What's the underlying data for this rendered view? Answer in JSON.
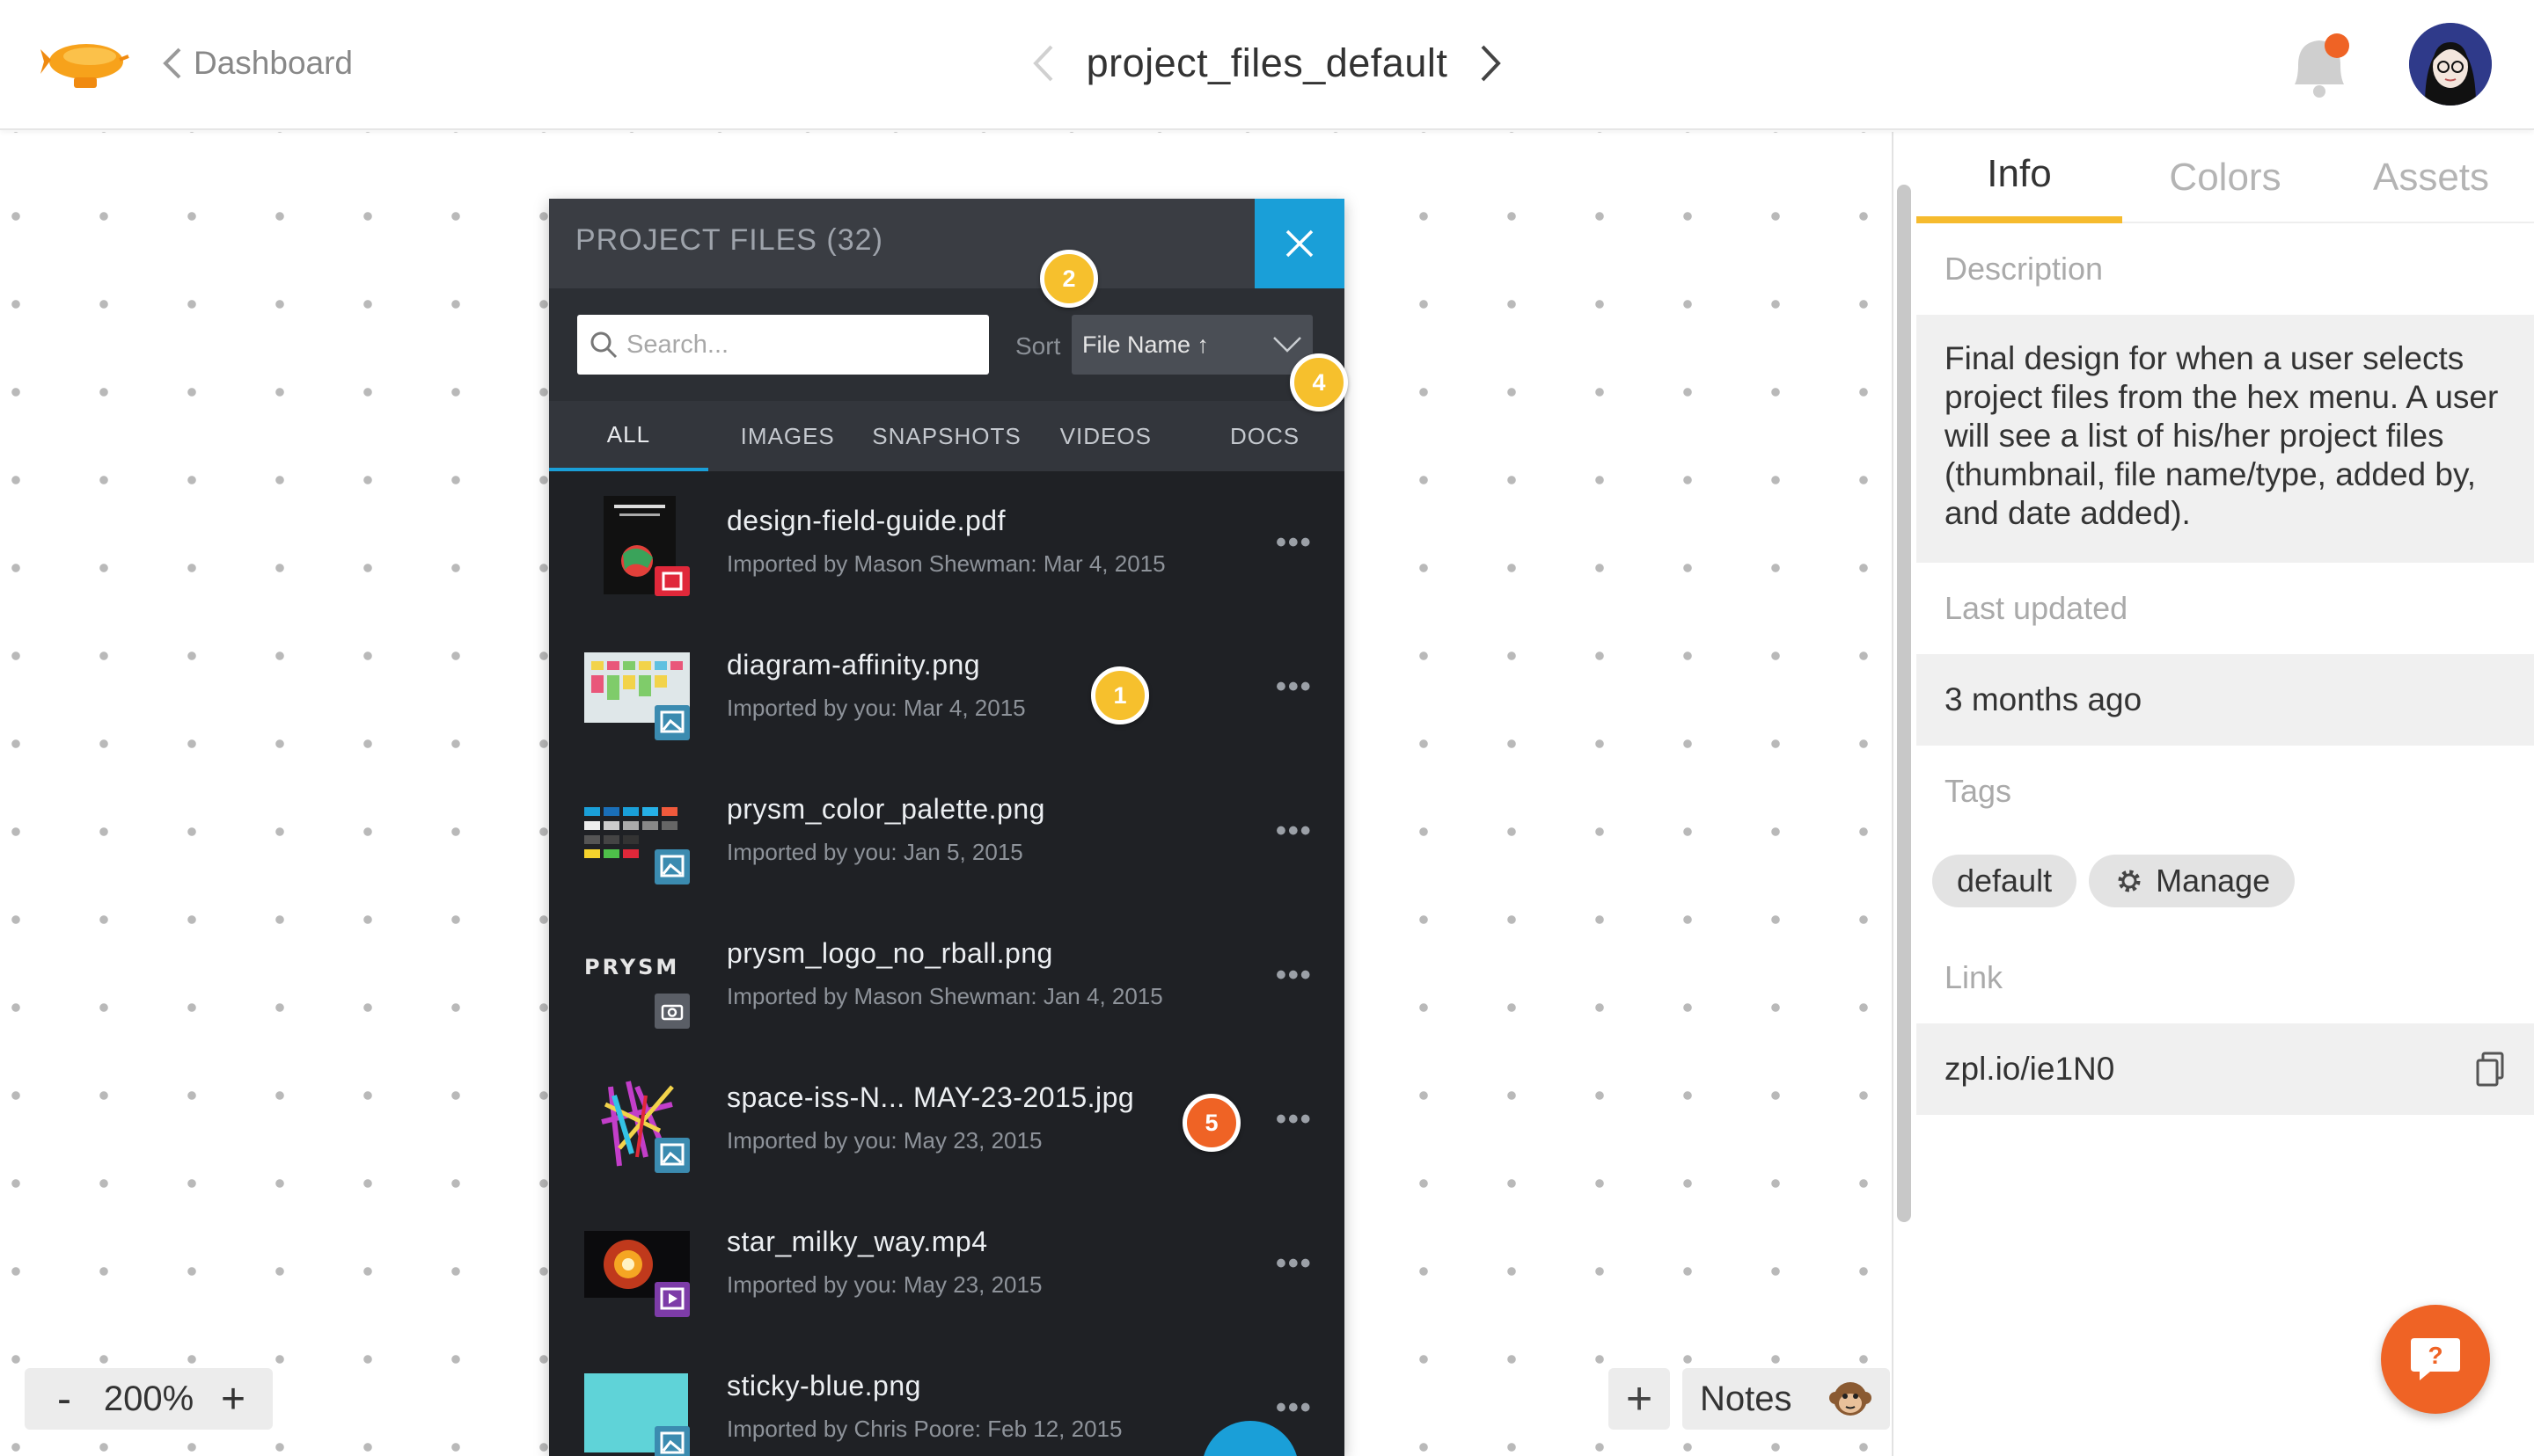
{
  "header": {
    "back_label": "Dashboard",
    "project_title": "project_files_default"
  },
  "canvas": {
    "zoom_minus": "-",
    "zoom_level": "200%",
    "zoom_plus": "+",
    "notes_add": "+",
    "notes_label": "Notes"
  },
  "project_files": {
    "title": "PROJECT FILES (32)",
    "search_placeholder": "Search...",
    "sort_label": "Sort",
    "sort_value": "File Name",
    "sort_direction_glyph": "↑",
    "tabs": [
      "ALL",
      "IMAGES",
      "SNAPSHOTS",
      "VIDEOS",
      "DOCS"
    ],
    "active_tab": "ALL",
    "files": [
      {
        "name": "design-field-guide.pdf",
        "meta": "Imported by Mason Shewman: Mar 4, 2015",
        "type": "pdf"
      },
      {
        "name": "diagram-affinity.png",
        "meta": "Imported by you: Mar 4, 2015",
        "type": "image"
      },
      {
        "name": "prysm_color_palette.png",
        "meta": "Imported by you: Jan 5, 2015",
        "type": "image"
      },
      {
        "name": "prysm_logo_no_rball.png",
        "meta": "Imported by Mason Shewman: Jan 4, 2015",
        "type": "snapshot"
      },
      {
        "name": "space-iss-N... MAY-23-2015.jpg",
        "meta": "Imported by you: May 23, 2015",
        "type": "image"
      },
      {
        "name": "star_milky_way.mp4",
        "meta": "Imported by you: May 23, 2015",
        "type": "video"
      },
      {
        "name": "sticky-blue.png",
        "meta": "Imported by Chris Poore: Feb 12, 2015",
        "type": "image"
      }
    ],
    "more_glyph": "•••",
    "prysm_logo_text": "PRYSM"
  },
  "markers": {
    "m1": "1",
    "m2": "2",
    "m4": "4",
    "m5": "5"
  },
  "right_panel": {
    "tabs": [
      "Info",
      "Colors",
      "Assets"
    ],
    "active_tab": "Info",
    "description_label": "Description",
    "description": "Final design for when a user selects project files from the hex menu. A user will see a list of his/her project files (thumbnail, file name/type, added by, and date added).",
    "last_updated_label": "Last updated",
    "last_updated": "3 months ago",
    "tags_label": "Tags",
    "tags": [
      "default"
    ],
    "manage_label": "Manage",
    "link_label": "Link",
    "link": "zpl.io/ie1N0"
  },
  "colors": {
    "accent_blue": "#1a9fd8",
    "accent_yellow": "#f6c02d",
    "accent_orange": "#ef6325",
    "panel_dark": "#1f2125"
  },
  "icons": {
    "logo": "zeppelin-logo-icon",
    "back": "chevron-left-icon",
    "next": "chevron-right-icon",
    "bell": "notification-bell-icon",
    "copy": "copy-icon",
    "gear": "gear-icon",
    "help": "help-chat-icon"
  }
}
